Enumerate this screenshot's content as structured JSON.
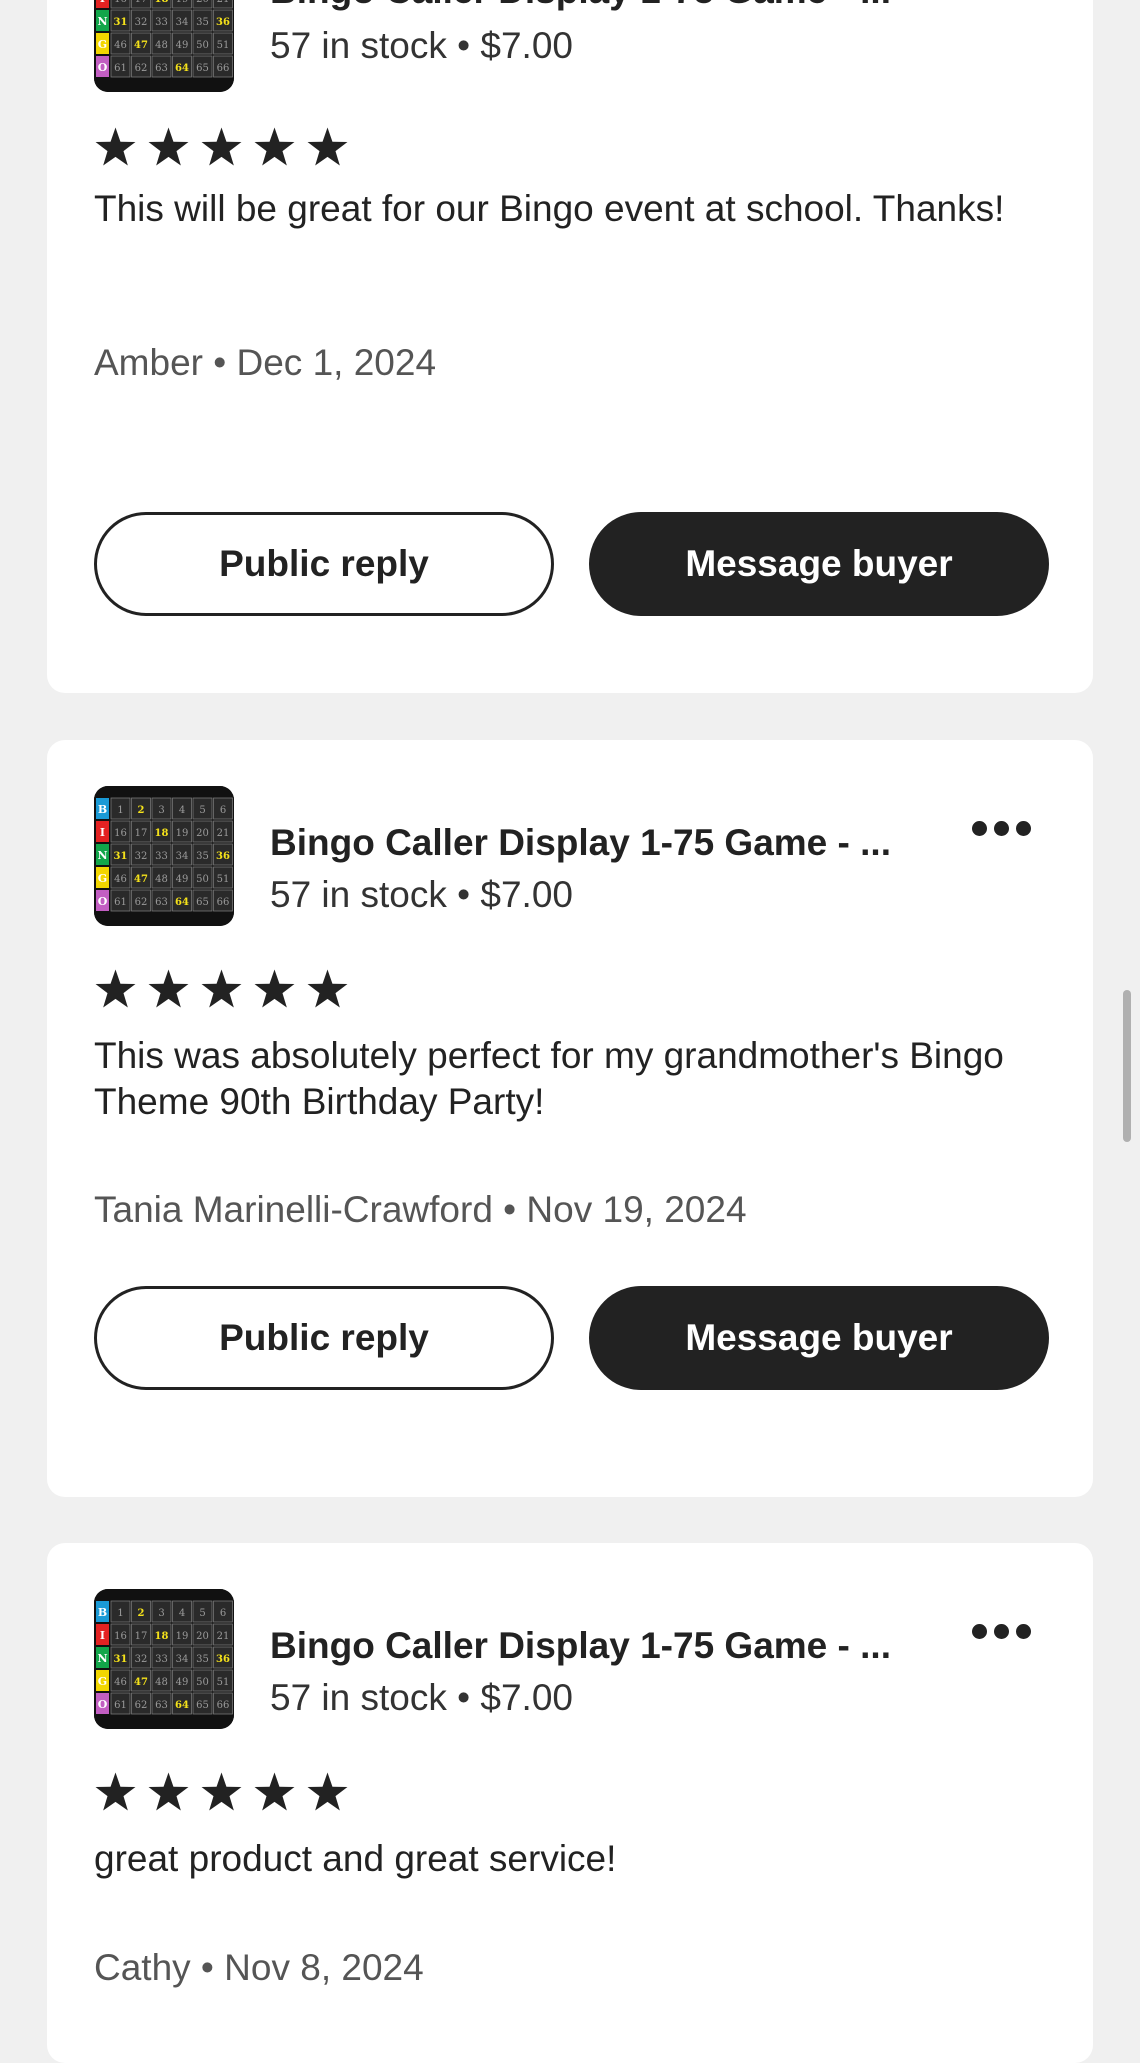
{
  "product": {
    "title": "Bingo Caller Display 1-75 Game - ...",
    "meta": "57 in stock • $7.00",
    "thumbnail_icon": "bingo-board-thumbnail",
    "board_letters": [
      "B",
      "I",
      "N",
      "G",
      "O"
    ],
    "board_numbers": [
      [
        "1",
        "2",
        "3",
        "4",
        "5",
        "6"
      ],
      [
        "16",
        "17",
        "18",
        "19",
        "20",
        "21"
      ],
      [
        "31",
        "32",
        "33",
        "34",
        "35",
        "36"
      ],
      [
        "46",
        "47",
        "48",
        "49",
        "50",
        "51"
      ],
      [
        "61",
        "62",
        "63",
        "64",
        "65",
        "66"
      ]
    ]
  },
  "labels": {
    "public_reply": "Public reply",
    "message_buyer": "Message buyer",
    "more_icon": "more-options-icon",
    "star_icon": "star-icon"
  },
  "reviews": [
    {
      "rating": 5,
      "text": "This will be great for our Bingo event at school. Thanks!",
      "byline": "Amber • Dec 1, 2024"
    },
    {
      "rating": 5,
      "text": "This was absolutely perfect for my grandmother's Bingo Theme 90th Birthday Party!",
      "byline": "Tania Marinelli-Crawford • Nov 19, 2024"
    },
    {
      "rating": 5,
      "text": "great product and great service!",
      "byline": "Cathy • Nov 8, 2024"
    }
  ],
  "colors": {
    "background": "#f0f0f0",
    "card": "#ffffff",
    "text": "#222222",
    "muted": "#555555",
    "primary_button": "#222222",
    "board_B": "#1a9ad6",
    "board_I": "#e32222",
    "board_N": "#12a64a",
    "board_G": "#f2d600",
    "board_O": "#c25ec2",
    "board_called": "#f5e21a"
  }
}
